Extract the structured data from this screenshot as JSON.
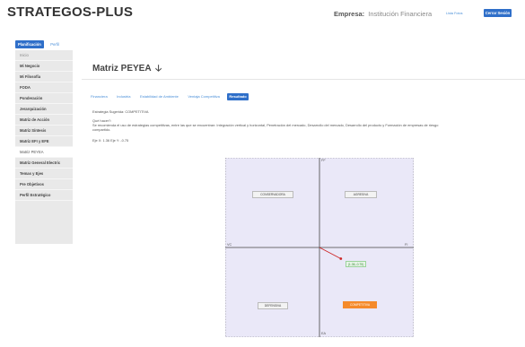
{
  "app": {
    "brand": "STRATEGOS-PLUS",
    "empresa_label": "Empresa:",
    "empresa_value": "Institución Financiera",
    "link_label": "Lista Fotos",
    "close_button": "Cerrar Sesión"
  },
  "top_tabs": [
    {
      "label": "Planificación",
      "active": true
    },
    {
      "label": "Perfil",
      "active": false
    }
  ],
  "sidebar": {
    "items": [
      {
        "label": "Inicio",
        "style": "plain"
      },
      {
        "label": "Mi Negocio",
        "style": "bold"
      },
      {
        "label": "Mi Filosofía",
        "style": "bold"
      },
      {
        "label": "FODA",
        "style": "bold"
      },
      {
        "label": "Ponderación",
        "style": "bold"
      },
      {
        "label": "Jerarquización",
        "style": "bold"
      },
      {
        "label": "Matriz de Acción",
        "style": "bold"
      },
      {
        "label": "Matriz Síntesis",
        "style": "bold"
      },
      {
        "label": "Matriz EFI y EFE",
        "style": "bold"
      },
      {
        "label": "Matriz PEYEA",
        "style": "active"
      },
      {
        "label": "Matriz General Electric",
        "style": "bold"
      },
      {
        "label": "Temas y Ejes",
        "style": "bold"
      },
      {
        "label": "Pre Objetivos",
        "style": "bold"
      },
      {
        "label": "Perfil Estratégico",
        "style": "bold"
      }
    ]
  },
  "main": {
    "title": "Matriz PEYEA",
    "title_icon": "download-arrow-icon",
    "subtabs": [
      {
        "label": "Financiera",
        "active": false
      },
      {
        "label": "Industria",
        "active": false
      },
      {
        "label": "Estabilidad de Ambiente",
        "active": false
      },
      {
        "label": "Ventaja Competitiva",
        "active": false
      },
      {
        "label": "Resultado",
        "active": true
      }
    ],
    "strategy_line": "Estrategia Sugerida: COMPETITIVA",
    "que_hacer": "Qué hacer?:",
    "recommendation_1": "Se recomienda el uso de estrategias competitivas, entre las que se encuentran: Integración vertical y horizontal, Penetración del mercado, Desarrollo del mercado, Desarrollo del producto y Formación de empresas de riesgo",
    "recommendation_2": "compartido.",
    "axes_line": "Eje X: 1.36  Eje Y: -0.75"
  },
  "chart_data": {
    "type": "scatter",
    "axis_labels": {
      "top": "FF",
      "bottom": "EA",
      "left": "VC",
      "right": "FI"
    },
    "quadrants": [
      {
        "label": "CONSERVADORA",
        "position": "top-left",
        "highlight": false
      },
      {
        "label": "AGRESIVA",
        "position": "top-right",
        "highlight": false
      },
      {
        "label": "DEFENSIVA",
        "position": "bottom-left",
        "highlight": false
      },
      {
        "label": "COMPETITIVA",
        "position": "bottom-right",
        "highlight": true
      }
    ],
    "point": {
      "x": 1.36,
      "y": -0.75,
      "label": "(1.36,-0.75)"
    },
    "xlim": [
      -6,
      6
    ],
    "ylim": [
      -6,
      6
    ],
    "colors": {
      "background": "#eae8f8",
      "axis": "#444444",
      "vector": "#cc2222",
      "highlight": "#f58a2a"
    }
  }
}
